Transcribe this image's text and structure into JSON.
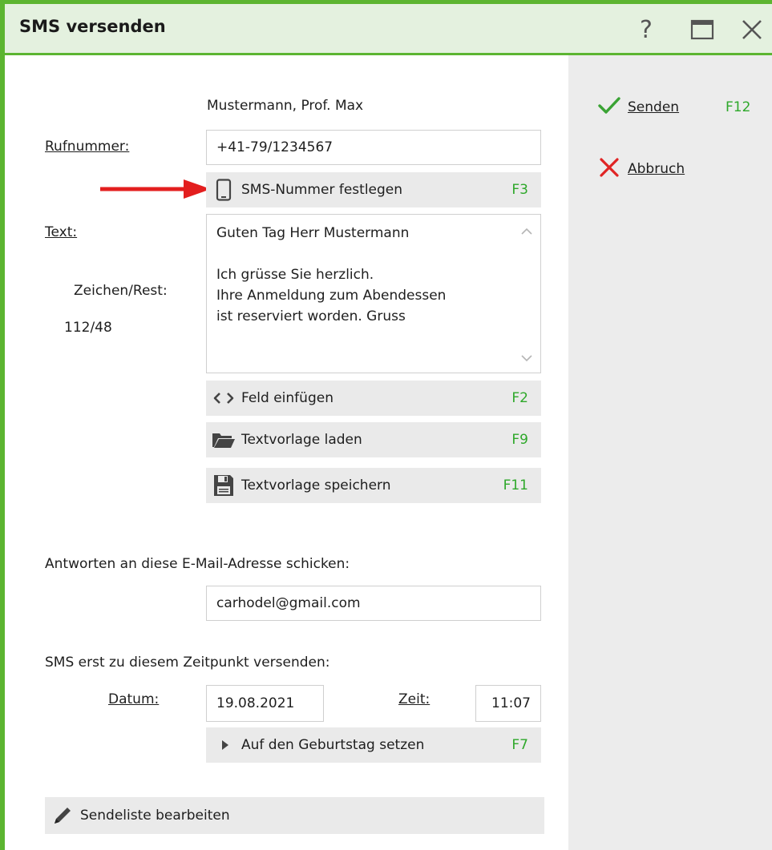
{
  "window": {
    "title": "SMS versenden",
    "help_glyph": "?"
  },
  "sidebar": {
    "send": {
      "label": "Senden",
      "fkey": "F12"
    },
    "cancel": {
      "label": "Abbruch",
      "fkey": ""
    }
  },
  "recipient": {
    "name": "Mustermann, Prof. Max"
  },
  "phone": {
    "label": "Rufnummer:",
    "value": "+41-79/1234567"
  },
  "sms_number_button": {
    "label": "SMS-Nummer festlegen",
    "fkey": "F3"
  },
  "text": {
    "label": "Text:",
    "counter_label": "Zeichen/Rest:",
    "counter_value": "112/48",
    "body": "Guten Tag Herr Mustermann\n\nIch grüsse Sie herzlich.\nIhre Anmeldung zum Abendessen\nist reserviert worden. Gruss"
  },
  "buttons": {
    "insert_field": {
      "label": "Feld einfügen",
      "fkey": "F2"
    },
    "load_template": {
      "label": "Textvorlage laden",
      "fkey": "F9"
    },
    "save_template": {
      "label": "Textvorlage speichern",
      "fkey": "F11"
    }
  },
  "reply": {
    "label": "Antworten an diese E-Mail-Adresse schicken:",
    "email": "carhodel@gmail.com"
  },
  "schedule": {
    "label": "SMS erst zu diesem Zeitpunkt versenden:",
    "date_label": "Datum:",
    "date_value": "19.08.2021",
    "time_label": "Zeit:",
    "time_value": "11:07",
    "birthday_button": {
      "label": "Auf den Geburtstag setzen",
      "fkey": "F7"
    }
  },
  "sendlist_button": {
    "label": "Sendeliste bearbeiten"
  },
  "colors": {
    "accent_green": "#5cb531",
    "fkey_green": "#2ea82a",
    "cancel_red": "#e02424",
    "arrow_red": "#e31e1e"
  },
  "icons": [
    "help-icon",
    "maximize-icon",
    "close-icon",
    "checkmark-icon",
    "x-icon",
    "phone-icon",
    "code-icon",
    "folder-icon",
    "save-icon",
    "triangle-right-icon",
    "pencil-icon",
    "red-arrow-icon"
  ]
}
